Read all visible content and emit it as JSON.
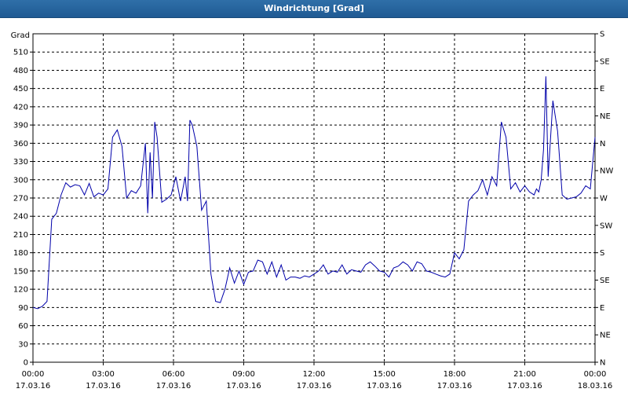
{
  "window": {
    "title": "Windrichtung [Grad]"
  },
  "chart_data": {
    "type": "line",
    "title": "Windrichtung [Grad]",
    "ylabel": "Grad",
    "ylim": [
      0,
      540
    ],
    "yticks": [
      0,
      30,
      60,
      90,
      120,
      150,
      180,
      210,
      240,
      270,
      300,
      330,
      360,
      390,
      420,
      450,
      480,
      510
    ],
    "right_axis_labels": [
      "N",
      "NE",
      "E",
      "SE",
      "S",
      "SW",
      "W",
      "NW",
      "N",
      "NE",
      "E",
      "SE",
      "S"
    ],
    "right_axis_values": [
      0,
      45,
      90,
      135,
      180,
      225,
      270,
      315,
      360,
      405,
      450,
      495,
      540
    ],
    "xlim_hours": [
      0,
      24
    ],
    "xticks": [
      {
        "hour": 0,
        "time": "00:00",
        "date": "17.03.16"
      },
      {
        "hour": 3,
        "time": "03:00",
        "date": "17.03.16"
      },
      {
        "hour": 6,
        "time": "06:00",
        "date": "17.03.16"
      },
      {
        "hour": 9,
        "time": "09:00",
        "date": "17.03.16"
      },
      {
        "hour": 12,
        "time": "12:00",
        "date": "17.03.16"
      },
      {
        "hour": 15,
        "time": "15:00",
        "date": "17.03.16"
      },
      {
        "hour": 18,
        "time": "18:00",
        "date": "17.03.16"
      },
      {
        "hour": 21,
        "time": "21:00",
        "date": "17.03.16"
      },
      {
        "hour": 24,
        "time": "00:00",
        "date": "18.03.16"
      }
    ],
    "grid": true,
    "line_color": "#0000aa",
    "series": [
      {
        "x": [
          0.0,
          0.2,
          0.4,
          0.6,
          0.8,
          1.0,
          1.2,
          1.4,
          1.6,
          1.8,
          2.0,
          2.2,
          2.4,
          2.6,
          2.8,
          3.0,
          3.2,
          3.4,
          3.6,
          3.8,
          4.0,
          4.2,
          4.4,
          4.6,
          4.8,
          4.9,
          5.0,
          5.1,
          5.2,
          5.3,
          5.5,
          5.7,
          5.9,
          6.1,
          6.3,
          6.5,
          6.6,
          6.7,
          6.8,
          7.0,
          7.2,
          7.4,
          7.6,
          7.8,
          8.0,
          8.2,
          8.4,
          8.6,
          8.8,
          9.0,
          9.2,
          9.4,
          9.6,
          9.8,
          10.0,
          10.2,
          10.4,
          10.6,
          10.8,
          11.0,
          11.2,
          11.4,
          11.6,
          11.8,
          12.0,
          12.2,
          12.4,
          12.6,
          12.8,
          13.0,
          13.2,
          13.4,
          13.6,
          13.8,
          14.0,
          14.2,
          14.4,
          14.6,
          14.8,
          15.0,
          15.2,
          15.4,
          15.6,
          15.8,
          16.0,
          16.2,
          16.4,
          16.6,
          16.8,
          17.0,
          17.2,
          17.4,
          17.6,
          17.8,
          18.0,
          18.2,
          18.4,
          18.6,
          18.8,
          19.0,
          19.2,
          19.4,
          19.6,
          19.8,
          20.0,
          20.2,
          20.4,
          20.6,
          20.8,
          21.0,
          21.2,
          21.4,
          21.5,
          21.6,
          21.7,
          21.8,
          21.9,
          22.0,
          22.2,
          22.4,
          22.6,
          22.8,
          23.0,
          23.2,
          23.4,
          23.6,
          23.8,
          24.0
        ],
        "y": [
          90,
          88,
          92,
          100,
          235,
          245,
          275,
          295,
          288,
          292,
          290,
          275,
          294,
          272,
          278,
          275,
          285,
          370,
          382,
          355,
          270,
          282,
          278,
          290,
          360,
          245,
          345,
          270,
          395,
          370,
          263,
          268,
          275,
          305,
          265,
          305,
          265,
          398,
          390,
          355,
          250,
          265,
          145,
          100,
          98,
          120,
          155,
          130,
          150,
          128,
          148,
          150,
          168,
          165,
          145,
          165,
          140,
          160,
          135,
          140,
          140,
          138,
          142,
          140,
          145,
          150,
          160,
          145,
          150,
          148,
          160,
          145,
          152,
          150,
          148,
          160,
          165,
          158,
          150,
          148,
          140,
          155,
          158,
          165,
          160,
          150,
          165,
          162,
          150,
          148,
          145,
          142,
          140,
          145,
          180,
          170,
          185,
          265,
          275,
          282,
          300,
          275,
          305,
          290,
          395,
          370,
          285,
          295,
          280,
          290,
          280,
          275,
          285,
          280,
          300,
          350,
          470,
          305,
          430,
          380,
          275,
          268,
          270,
          272,
          278,
          290,
          285,
          370
        ]
      }
    ]
  }
}
